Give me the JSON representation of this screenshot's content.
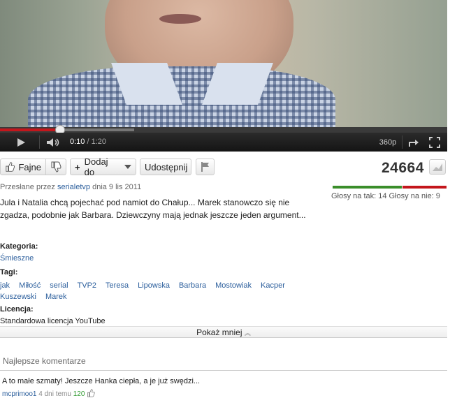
{
  "player": {
    "current_time": "0:10",
    "duration": "/ 1:20",
    "progress": 0.125,
    "buffered": 0.3,
    "quality": "360p"
  },
  "actions": {
    "like_label": "Fajne",
    "add_label": "Dodaj do",
    "share_label": "Udostępnij"
  },
  "stats": {
    "views": "24664",
    "votes_text": "Głosy na tak: 14 Głosy na nie: 9",
    "likes": 14,
    "dislikes": 9,
    "colors": {
      "like": "#3a8e2a",
      "dislike": "#c4161c"
    }
  },
  "meta": {
    "uploaded_prefix": "Przesłane przez",
    "uploader": "serialetvp",
    "uploaded_date": "dnia 9 lis 2011"
  },
  "description": "Jula i Natalia chcą pojechać pod namiot do Chałup... Marek stanowczo się nie zgadza, podobnie jak Barbara. Dziewczyny mają jednak jeszcze jeden argument...",
  "category": {
    "label": "Kategoria:",
    "value": "Śmieszne"
  },
  "tags": {
    "label": "Tagi:",
    "items": [
      "jak",
      "Miłość",
      "serial",
      "TVP2",
      "Teresa",
      "Lipowska",
      "Barbara",
      "Mostowiak",
      "Kacper",
      "Kuszewski",
      "Marek"
    ]
  },
  "license": {
    "label": "Licencja:",
    "value": "Standardowa licencja YouTube"
  },
  "show_less": "Pokaż mniej",
  "comments": {
    "heading": "Najlepsze komentarze",
    "items": [
      {
        "text": "A to małe szmaty! Jeszcze Hanka ciepła, a je już swędzi...",
        "user": "mcprimoo1",
        "age": "4 dni temu",
        "score": "120"
      }
    ]
  }
}
